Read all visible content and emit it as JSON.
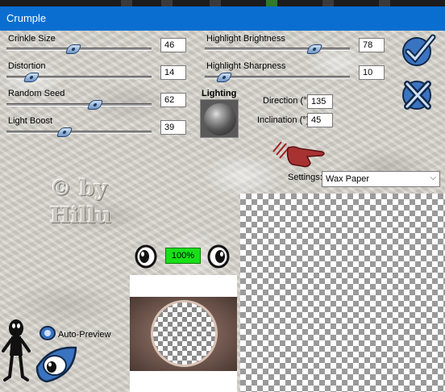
{
  "window": {
    "title": "Crumple"
  },
  "sliders_left": [
    {
      "label": "Crinkle Size",
      "value": "46",
      "fraction": 0.46
    },
    {
      "label": "Distortion",
      "value": "14",
      "fraction": 0.14
    },
    {
      "label": "Random Seed",
      "value": "62",
      "fraction": 0.62
    },
    {
      "label": "Light Boost",
      "value": "39",
      "fraction": 0.39
    }
  ],
  "sliders_right": [
    {
      "label": "Highlight Brightness",
      "value": "78",
      "fraction": 0.78
    },
    {
      "label": "Highlight Sharpness",
      "value": "10",
      "fraction": 0.1
    }
  ],
  "lighting": {
    "label": "Lighting",
    "direction_label": "Direction (°)",
    "direction_value": "135",
    "inclination_label": "Inclination (°)",
    "inclination_value": "45"
  },
  "settings": {
    "label": "Settings:",
    "selected": "Wax Paper"
  },
  "watermark": {
    "line1": "© by",
    "line2": "Hillu"
  },
  "zoom": {
    "value": "100%"
  },
  "auto_preview": {
    "label": "Auto-Preview"
  },
  "icons": {
    "ok": "checkmark-ok-icon",
    "cancel": "x-cancel-icon",
    "pointer": "pointing-hand-icon",
    "zoom_out": "zoom-out-icon",
    "zoom_in": "zoom-in-icon",
    "mascot": "mascot-figure-icon",
    "preview_eye": "eye-preview-icon"
  },
  "colors": {
    "titlebar": "#0a6ed1",
    "zoom_box": "#18e018",
    "accent_blue": "#3a74c0"
  }
}
